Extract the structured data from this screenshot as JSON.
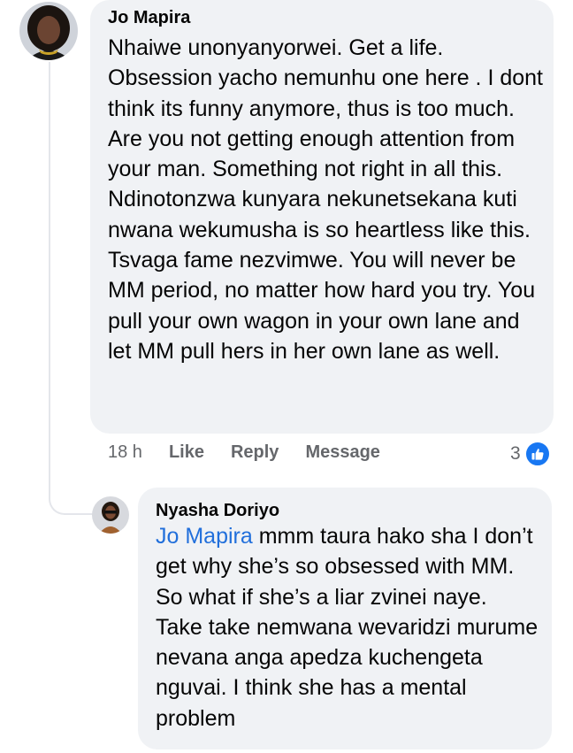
{
  "comment": {
    "author": "Jo Mapira",
    "text": "Nhaiwe unonyanyorwei. Get a life. Obsession yacho nemunhu one here . I dont think its funny anymore, thus is too much. Are you not getting enough attention from your man. Something not right in all this. Ndinotonzwa kunyara nekunetsekana kuti nwana wekumusha is so heartless like this. Tsvaga fame nezvimwe. You will never be MM period, no matter how hard you try. You pull your own wagon in your own lane and let MM pull hers in her own lane as well.",
    "time": "18 h",
    "actions": {
      "like": "Like",
      "reply": "Reply",
      "message": "Message"
    },
    "reaction_count": "3",
    "reaction_icon": "thumbs-up-icon"
  },
  "reply": {
    "author": "Nyasha Doriyo",
    "mention": "Jo Mapira",
    "text": " mmm taura hako sha I don’t get why she’s so obsessed with MM. So what if she’s a liar zvinei naye. Take take nemwana wevaridzi murume nevana anga apedza kuchengeta nguvai. I think she has a mental problem"
  },
  "colors": {
    "bubble": "#f0f2f5",
    "mention": "#216fdb",
    "meta": "#65676b",
    "like_blue": "#1877f2"
  }
}
